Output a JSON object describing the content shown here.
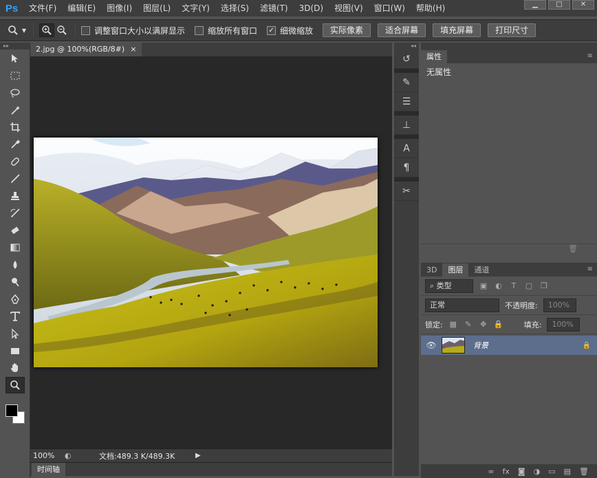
{
  "menubar": {
    "logo": "Ps",
    "items": [
      "文件(F)",
      "编辑(E)",
      "图像(I)",
      "图层(L)",
      "文字(Y)",
      "选择(S)",
      "滤镜(T)",
      "3D(D)",
      "视图(V)",
      "窗口(W)",
      "帮助(H)"
    ],
    "window_controls": [
      "▁",
      "□",
      "✕"
    ]
  },
  "options": {
    "resize_windows": "调整窗口大小以满屏显示",
    "zoom_all_windows": "缩放所有窗口",
    "scrubby_zoom": "细微缩放",
    "actual_pixels": "实际像素",
    "fit_screen": "适合屏幕",
    "fill_screen": "填充屏幕",
    "print_size": "打印尺寸",
    "resize_checked": false,
    "zoom_all_checked": false,
    "scrubby_checked": true
  },
  "document": {
    "tab_title": "2.jpg @ 100%(RGB/8#)",
    "tab_close": "×",
    "zoom": "100%",
    "doc_info": "文档:489.3 K/489.3K",
    "timeline_tab": "时间轴"
  },
  "properties": {
    "tab": "属性",
    "body": "无属性"
  },
  "layers": {
    "tabs": [
      "3D",
      "图层",
      "通道"
    ],
    "filter_kind": "类型",
    "blend_mode": "正常",
    "opacity_label": "不透明度:",
    "opacity_value": "100%",
    "lock_label": "锁定:",
    "fill_label": "填充:",
    "fill_value": "100%",
    "layer_name": "背景"
  },
  "icons": {
    "eye": "eye-icon",
    "lock": "lock-icon",
    "zoom": "zoom-icon"
  }
}
